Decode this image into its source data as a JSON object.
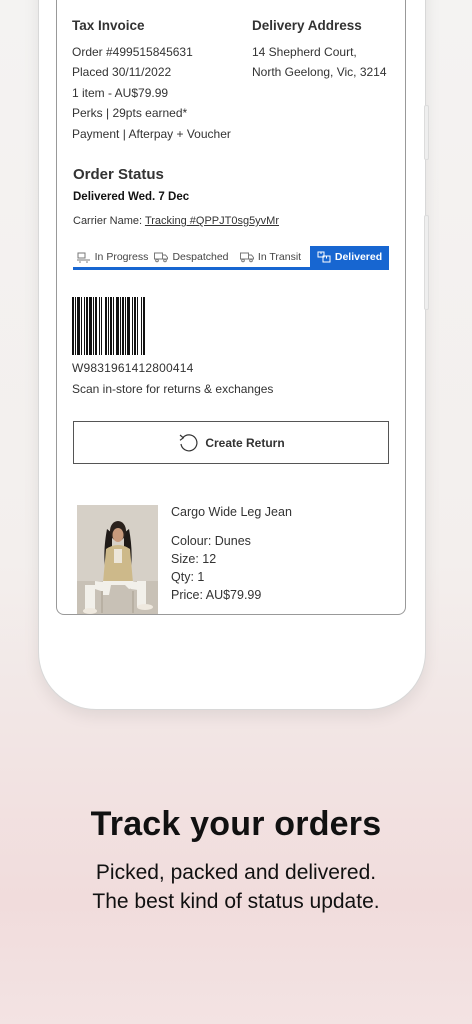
{
  "invoice": {
    "title": "Tax Invoice",
    "order": "Order #499515845631",
    "placed": "Placed 30/11/2022",
    "items": "1 item - AU$79.99",
    "perks": "Perks  |  29pts earned*",
    "payment": "Payment | Afterpay + Voucher"
  },
  "delivery": {
    "title": "Delivery Address",
    "line1": "14 Shepherd Court,",
    "line2": "North Geelong, Vic, 3214"
  },
  "order_status": {
    "title": "Order Status",
    "subtitle": "Delivered Wed. 7 Dec",
    "carrier_label": "Carrier Name: ",
    "tracking": "Tracking #QPPJT0sg5yvMr",
    "tabs": [
      {
        "label": "In Progress",
        "icon": "conveyor-icon"
      },
      {
        "label": "Despatched",
        "icon": "truck-icon"
      },
      {
        "label": "In Transit",
        "icon": "truck-icon"
      },
      {
        "label": "Delivered",
        "icon": "delivered-box-icon"
      }
    ],
    "active_tab": "Delivered",
    "accent": "#1766d1"
  },
  "barcode": {
    "number": "W9831961412800414",
    "instruction": "Scan in-store for returns & exchanges"
  },
  "return_button": {
    "label": "Create Return",
    "icon": "return-arrow-icon"
  },
  "product": {
    "name": "Cargo Wide Leg Jean",
    "colour": "Colour: Dunes",
    "size": "Size: 12",
    "qty": "Qty: 1",
    "price": "Price: AU$79.99"
  },
  "promo": {
    "headline": "Track your orders",
    "line1": "Picked, packed and delivered.",
    "line2": "The best kind of status update."
  }
}
